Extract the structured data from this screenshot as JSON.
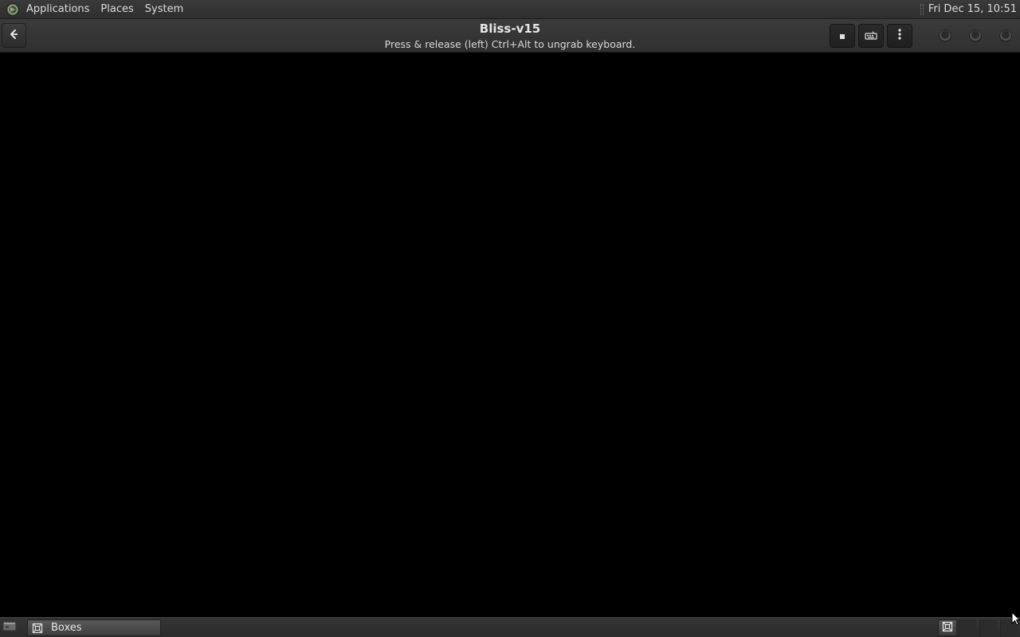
{
  "top_panel": {
    "menu": [
      {
        "label": "Applications"
      },
      {
        "label": "Places"
      },
      {
        "label": "System"
      }
    ],
    "clock": "Fri Dec 15, 10:51",
    "logo_icon": "mate-logo-icon"
  },
  "window": {
    "title": "Bliss-v15",
    "subtitle": "Press & release (left) Ctrl+Alt to ungrab keyboard.",
    "buttons": {
      "back_icon": "back-arrow-icon",
      "send_key_icon": "stop-square-icon",
      "keyboard_icon": "keyboard-icon",
      "menu_icon": "vertical-dots-icon"
    },
    "controls": [
      "minimize",
      "maximize",
      "close"
    ],
    "display_background": "#000000"
  },
  "bottom_panel": {
    "show_desktop_icon": "show-desktop-icon",
    "tasks": [
      {
        "label": "Boxes",
        "icon": "boxes-app-icon"
      }
    ],
    "tray_icon": "boxes-tray-icon"
  }
}
